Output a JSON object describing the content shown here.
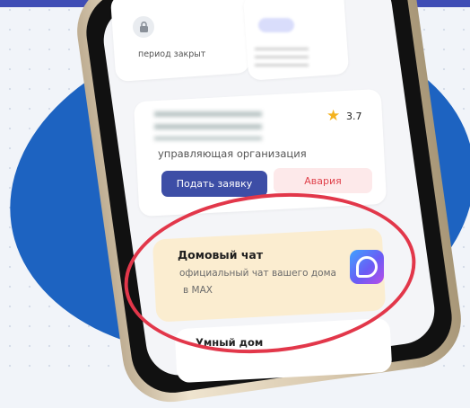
{
  "colors": {
    "accent_blue": "#3d4ea6",
    "alarm_red": "#e0424c",
    "highlight_circle": "#e2374a",
    "chat_card_bg": "#fbedd0",
    "background_blob": "#1d63c1"
  },
  "top_card": {
    "lock_icon": "lock-icon",
    "period_text": "период закрыт"
  },
  "org_card": {
    "rating": "3.7",
    "role_label": "управляющая организация",
    "request_button": "Подать заявку",
    "alarm_button": "Авария"
  },
  "chat_card": {
    "title": "Домовый чат",
    "subtitle_line1": "официальный чат вашего дома",
    "subtitle_line2": "в MAX",
    "logo_icon": "max-logo-icon"
  },
  "smart_home": {
    "title": "Умный дом"
  }
}
